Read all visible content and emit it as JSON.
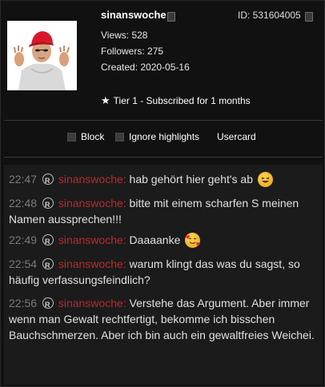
{
  "user": {
    "username": "sinanswoche",
    "id_text": "ID: 531604005",
    "views": "Views: 528",
    "followers": "Followers: 275",
    "created": "Created: 2020-05-16",
    "tier": "Tier 1 - Subscribed for 1 months"
  },
  "controls": {
    "block": "Block",
    "ignore_highlights": "Ignore highlights",
    "usercard": "Usercard"
  },
  "messages": [
    {
      "time": "22:47",
      "author": "sinanswoche:",
      "text": "hab gehört hier geht's ab",
      "emote": "grinning-squint-emoji"
    },
    {
      "time": "22:48",
      "author": "sinanswoche:",
      "text": "bitte mit einem scharfen S meinen Namen aussprechen!!!"
    },
    {
      "time": "22:49",
      "author": "sinanswoche:",
      "text": "Daaaanke",
      "emote": "smiling-hearts-emoji"
    },
    {
      "time": "22:54",
      "author": "sinanswoche:",
      "text": "warum klingt das was du sagst, so häufig verfassungsfeindlich?"
    },
    {
      "time": "22:56",
      "author": "sinanswoche:",
      "text": "Verstehe das Argument. Aber immer wenn man Gewalt rechtfertigt, bekomme ich bisschen Bauchschmerzen. Aber ich bin auch ein gewaltfreies Weichei."
    }
  ],
  "colors": {
    "username": "#b92a2a",
    "timestamp": "#7a7a7a",
    "background": "#111111",
    "chat_background": "#1b1b1b"
  }
}
